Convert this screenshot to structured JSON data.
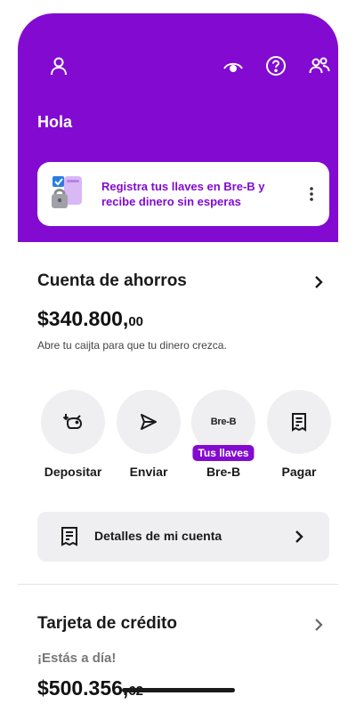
{
  "header": {
    "greeting": "Hola",
    "icons": [
      "profile-icon",
      "eye-icon",
      "help-icon",
      "users-icon"
    ],
    "background_color": "#820ad1"
  },
  "banner": {
    "text": "Registra tus llaves en Bre-B y recibe dinero sin esperas",
    "accent_color": "#820ad1"
  },
  "savings": {
    "title": "Cuenta de ahorros",
    "balance_main": "$340.800,",
    "balance_cents": "00",
    "subtext": "Abre tu caijta para que tu dinero crezca."
  },
  "actions": [
    {
      "label": "Depositar",
      "icon": "piggy-bank-icon"
    },
    {
      "label": "Enviar",
      "icon": "send-icon"
    },
    {
      "label": "Bre-B",
      "icon": "bre-b-logo",
      "logo_text": "Bre-B",
      "badge": "Tus llaves"
    },
    {
      "label": "Pagar",
      "icon": "receipt-icon"
    }
  ],
  "details": {
    "label": "Detalles de mi cuenta"
  },
  "credit": {
    "title": "Tarjeta de crédito",
    "status": "¡Estás a día!",
    "balance_main": "$500.356,",
    "balance_cents": "62"
  }
}
